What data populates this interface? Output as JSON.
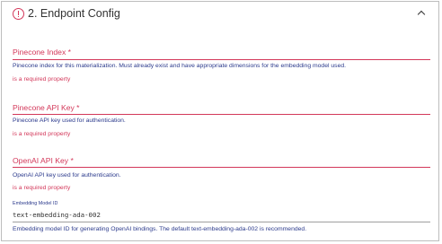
{
  "section": {
    "title": "2. Endpoint Config",
    "status_icon": "error-circle-icon",
    "toggle_icon": "chevron-up-icon"
  },
  "fields": {
    "pinecone_index": {
      "label": "Pinecone Index *",
      "helper": "Pinecone index for this materialization. Must already exist and have appropriate dimensions for the embedding model used.",
      "error": "is a required property"
    },
    "pinecone_api_key": {
      "label": "Pinecone API Key *",
      "helper": "Pinecone API key used for authentication.",
      "error": "is a required property"
    },
    "openai_api_key": {
      "label": "OpenAI API Key *",
      "helper": "OpenAI API key used for authentication.",
      "error": "is a required property"
    },
    "embedding_model_id": {
      "label": "Embedding Model ID",
      "value": "text-embedding-ada-002",
      "helper": "Embedding model ID for generating OpenAI bindings. The default text-embedding-ada-002 is recommended."
    }
  },
  "colors": {
    "error": "#d3385a",
    "helper_text": "#2b3a8c",
    "border": "#bdbdbd"
  }
}
